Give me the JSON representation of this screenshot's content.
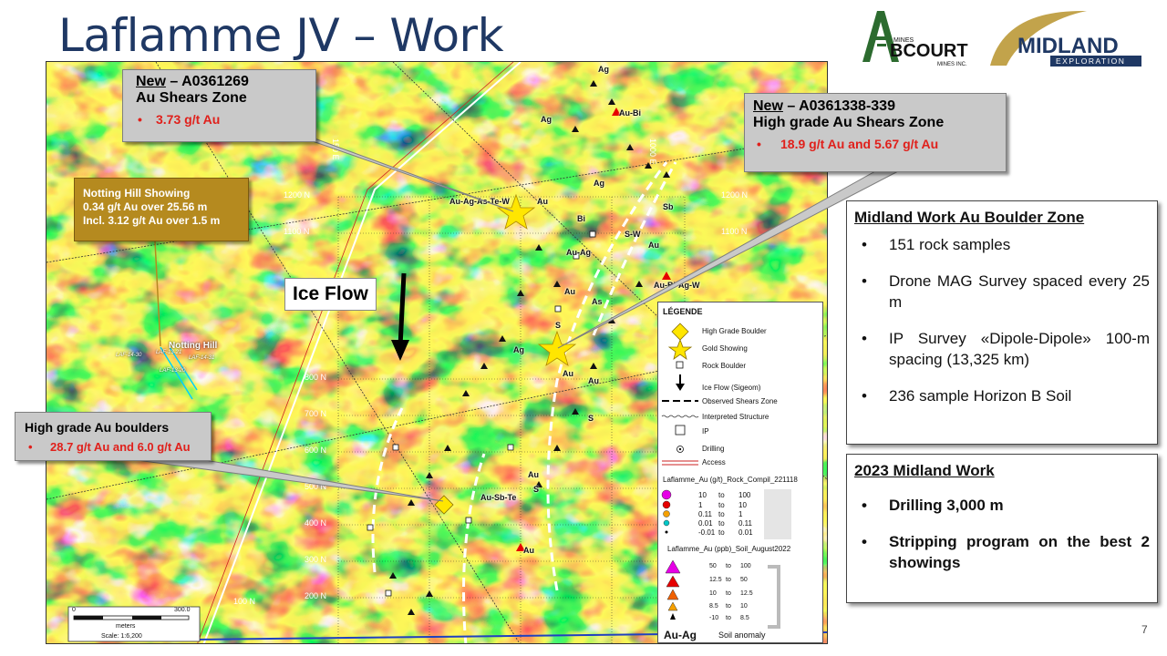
{
  "slide": {
    "title": "Laflamme JV – Work",
    "page_number": "7"
  },
  "logos": {
    "abcourt": {
      "small_top": "MINES",
      "name": "BCOURT",
      "small_bottom": "MINES INC."
    },
    "midland": {
      "name": "MIDLAND",
      "tagline": "EXPLORATION"
    }
  },
  "callouts": {
    "shears": {
      "new": "New",
      "id": " – A0361269",
      "title": "Au Shears Zone",
      "bullet": "3.73 g/t Au"
    },
    "high_grade_shears": {
      "new": "New",
      "id": " – A0361338-339",
      "title": "High grade Au Shears Zone",
      "bullet": "18.9 g/t Au and 5.67 g/t Au"
    },
    "notting": {
      "title": "Notting Hill Showing",
      "line1": "0.34 g/t Au  over 25.56 m",
      "line2": "Incl. 3.12 g/t Au  over 1.5 m"
    },
    "boulders": {
      "title": "High grade Au boulders",
      "bullet": "28.7 g/t Au and 6.0 g/t Au"
    }
  },
  "panels": {
    "work": {
      "title": "Midland  Work Au Boulder Zone",
      "items": [
        "151 rock samples",
        "Drone MAG Survey spaced every 25 m",
        "IP Survey «Dipole-Dipole» 100-m spacing (13,325 km)",
        "236 sample Horizon B Soil"
      ]
    },
    "work2023": {
      "title": "2023 Midland  Work",
      "items": [
        "Drilling 3,000 m",
        "Stripping program on the best 2 showings"
      ]
    }
  },
  "map": {
    "ice_flow_label": "Ice Flow",
    "notting_hill_label": "Notting Hill",
    "au_ag_label": "Au-Ag",
    "soil_anomaly": "Soil anomaly",
    "scale": {
      "zero": "0",
      "max": "300.0",
      "unit": "meters",
      "ratio": "Scale: 1:6,200"
    },
    "grid_labels": [
      "1200 N",
      "1100 N",
      "800 N",
      "700 N",
      "600 N",
      "500 N",
      "400 N",
      "300 N",
      "200 N",
      "100 N",
      "1200 N",
      "1100 N",
      "150 E",
      "1000 E"
    ],
    "sample_labels": [
      "Ag",
      "Au-Bi",
      "Ag",
      "Au-Ag-As-Te-W",
      "Au",
      "Bi",
      "Au-Ag",
      "Au",
      "As",
      "Ag",
      "S",
      "Au",
      "Au",
      "S",
      "Au",
      "Au-Sb-Te",
      "S",
      "Au",
      "Au-Bi-Ag-W",
      "Sb",
      "S-W",
      "Au",
      "Ag"
    ],
    "drill_labels": [
      "LAF-14-30",
      "LAF-13-21",
      "LAF-14-31",
      "LAF-13-20"
    ]
  },
  "legend": {
    "title": "LÉGENDE",
    "items": [
      "High Grade Boulder",
      "Gold Showing",
      "Rock Boulder",
      "Ice Flow (Sigeom)",
      "Observed Shears Zone",
      "Interpreted Structure",
      "IP",
      "Drilling",
      "Access"
    ],
    "rock_title": "Laflamme_Au (g/t)_Rock_Compil_221118",
    "rock_rows": [
      {
        "from": "10",
        "to": "100",
        "color": "#e600e6"
      },
      {
        "from": "1",
        "to": "10",
        "color": "#e60000"
      },
      {
        "from": "0.11",
        "to": "1",
        "color": "#f5a000"
      },
      {
        "from": "0.01",
        "to": "0.11",
        "color": "#00c8c8"
      },
      {
        "from": "-0.01",
        "to": "0.01",
        "color": "#000000"
      }
    ],
    "soil_title": "Laflamme_Au (ppb)_Soil_August2022",
    "soil_rows": [
      {
        "from": "50",
        "to": "100",
        "color": "#e600e6"
      },
      {
        "from": "12.5",
        "to": "50",
        "color": "#e60000"
      },
      {
        "from": "10",
        "to": "12.5",
        "color": "#f06000"
      },
      {
        "from": "8.5",
        "to": "10",
        "color": "#f5a000"
      },
      {
        "from": "-10",
        "to": "8.5",
        "color": "#000000"
      }
    ],
    "to": "to"
  },
  "colors": {
    "title": "#1f3864",
    "callout_grey": "#c9c9c9",
    "callout_gold": "#b58a1f",
    "red_text": "#e0201b",
    "star": "#ffe600"
  }
}
